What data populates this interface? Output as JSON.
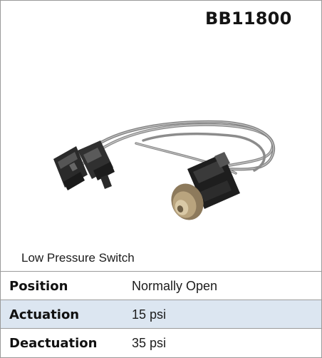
{
  "product": {
    "part_number": "BB11800",
    "caption": "Low Pressure Switch"
  },
  "specs": [
    {
      "label": "Position",
      "value": "Normally Open"
    },
    {
      "label": "Actuation",
      "value": "15 psi"
    },
    {
      "label": "Deactuation",
      "value": "35 psi"
    }
  ],
  "colors": {
    "shaded_row": "#dce6f1",
    "border": "#9a9a9a"
  }
}
